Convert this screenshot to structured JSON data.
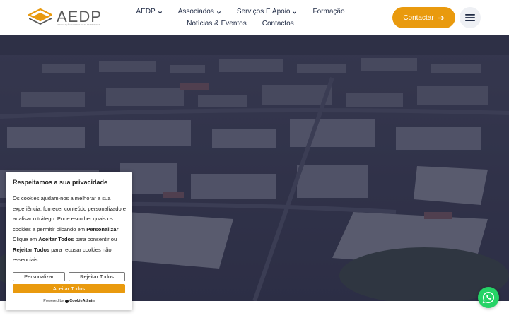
{
  "brand": {
    "name": "AEDP",
    "tagline": "ASSOCIAÇÃO EMPRESARIAL DE PAREDES",
    "accent": "#e99a0e",
    "navy": "#1f2a44"
  },
  "nav": {
    "row1": [
      {
        "label": "AEDP",
        "dropdown": true
      },
      {
        "label": "Associados",
        "dropdown": true
      },
      {
        "label": "Serviços E Apoio",
        "dropdown": true
      },
      {
        "label": "Formação",
        "dropdown": false
      }
    ],
    "row2": [
      {
        "label": "Notícias & Eventos",
        "dropdown": false
      },
      {
        "label": "Contactos",
        "dropdown": false
      }
    ]
  },
  "header_cta": {
    "label": "Contactar",
    "icon": "arrow-right-icon"
  },
  "menu": {
    "icon": "hamburger-icon"
  },
  "hero": {
    "image": "aerial-industrial-park"
  },
  "cookie": {
    "title": "Respeitamos a sua privacidade",
    "text_1": "Os cookies ajudam-nos a melhorar a sua experiência, fornecer conteúdo personalizado e analisar o tráfego. Pode escolher quais os cookies a permitir clicando em ",
    "strong_1": "Personalizar",
    "text_2": ". Clique em ",
    "strong_2": "Aceitar Todos",
    "text_3": " para consentir ou ",
    "strong_3": "Rejeitar Todos",
    "text_4": " para recusar cookies não essenciais.",
    "customize_label": "Personalizar",
    "reject_label": "Rejeitar Todos",
    "accept_label": "Aceitar Todos",
    "powered_by": "Powered by",
    "powered_brand": "CookieAdmin"
  },
  "whatsapp": {
    "icon": "whatsapp-icon",
    "color": "#25d366"
  }
}
